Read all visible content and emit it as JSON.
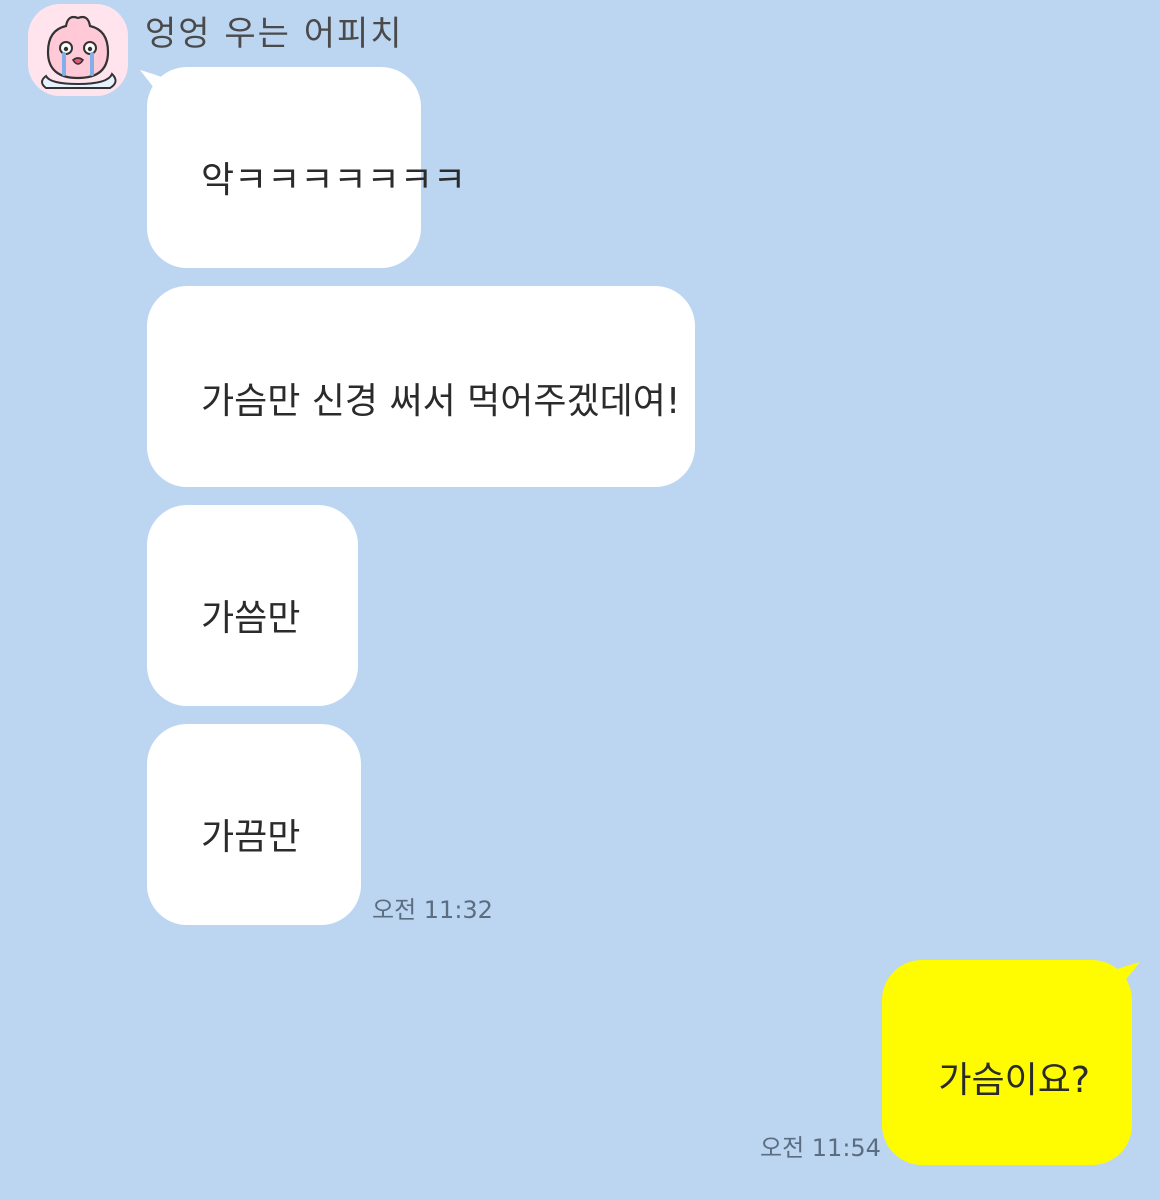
{
  "chat": {
    "sender_name": "엉엉 우는 어피치",
    "incoming": [
      {
        "text": "악ㅋㅋㅋㅋㅋㅋㅋ"
      },
      {
        "text": "가슴만 신경 써서 먹어주겠데여!"
      },
      {
        "text": "가씀만"
      },
      {
        "text": "가끔만"
      }
    ],
    "incoming_time": "오전 11:32",
    "outgoing": [
      {
        "text": "가슴이요?"
      }
    ],
    "outgoing_time": "오전 11:54"
  },
  "icons": {
    "avatar": "crying-apeach-avatar-icon"
  },
  "colors": {
    "background": "#bcd6f2",
    "incoming_bubble": "#ffffff",
    "outgoing_bubble": "#fffb00"
  }
}
